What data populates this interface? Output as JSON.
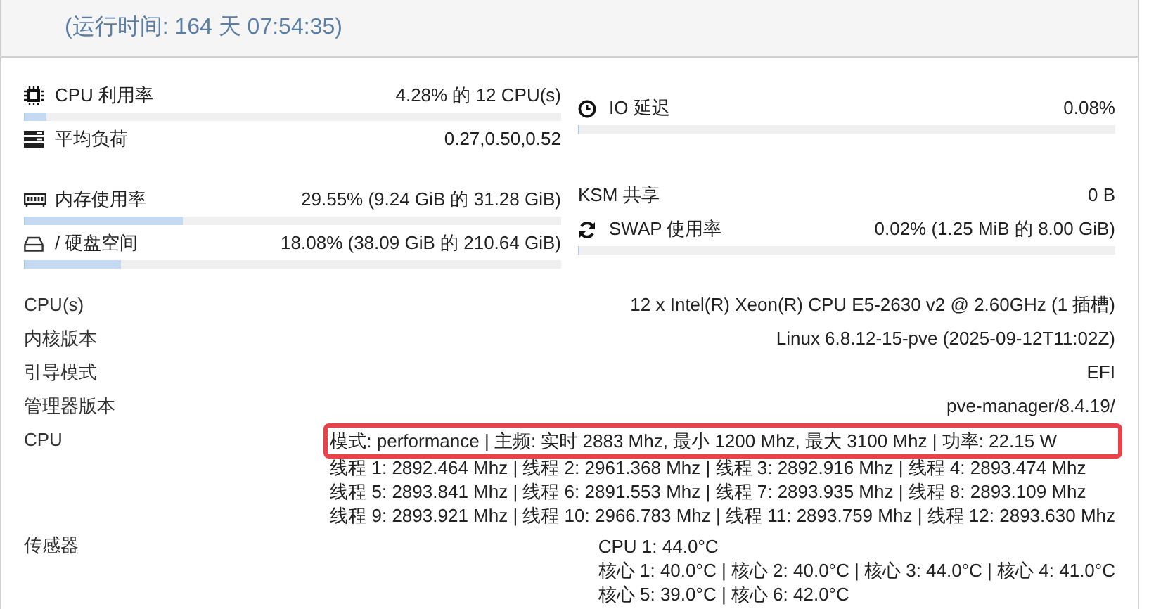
{
  "header": {
    "title": "(运行时间: 164 天 07:54:35)"
  },
  "summary_left": [
    {
      "label": "CPU 利用率",
      "value": "4.28% 的 12 CPU(s)",
      "level": 0.0428
    },
    {
      "label": "平均负荷",
      "value": "0.27,0.50,0.52"
    },
    {
      "label": "内存使用率",
      "value": "29.55% (9.24 GiB 的 31.28 GiB)",
      "level": 0.2955
    },
    {
      "label": "/ 硬盘空间",
      "value": "18.08% (38.09 GiB 的 210.64 GiB)",
      "level": 0.1808
    }
  ],
  "summary_right": [
    {
      "label": "IO 延迟",
      "value": "0.08%",
      "level": 0.0008
    },
    {
      "label": "KSM 共享",
      "value": "0 B"
    },
    {
      "label": "SWAP 使用率",
      "value": "0.02% (1.25 MiB 的 8.00 GiB)",
      "level": 0.0002
    }
  ],
  "details": [
    {
      "label": "CPU(s)",
      "lines": [
        {
          "text": "12 x Intel(R) Xeon(R) CPU E5-2630 v2 @ 2.60GHz (1 插槽)",
          "highlighted": false
        }
      ]
    },
    {
      "label": "内核版本",
      "lines": [
        {
          "text": "Linux 6.8.12-15-pve (2025-09-12T11:02Z)",
          "highlighted": false
        }
      ]
    },
    {
      "label": "引导模式",
      "lines": [
        {
          "text": "EFI",
          "highlighted": false
        }
      ]
    },
    {
      "label": "管理器版本",
      "lines": [
        {
          "text": "pve-manager/8.4.19/",
          "highlighted": false
        }
      ]
    },
    {
      "label": "CPU",
      "lines": [
        {
          "text": "模式: performance | 主频: 实时 2883 Mhz, 最小 1200 Mhz, 最大 3100 Mhz | 功率: 22.15 W",
          "highlighted": true
        },
        {
          "text": "线程 1: 2892.464 Mhz | 线程 2: 2961.368 Mhz | 线程 3: 2892.916 Mhz | 线程 4: 2893.474 Mhz",
          "highlighted": false
        },
        {
          "text": "线程 5: 2893.841 Mhz | 线程 6: 2891.553 Mhz | 线程 7: 2893.935 Mhz | 线程 8: 2893.109 Mhz",
          "highlighted": false
        },
        {
          "text": "线程 9: 2893.921 Mhz | 线程 10: 2966.783 Mhz | 线程 11: 2893.759 Mhz | 线程 12: 2893.630 Mhz",
          "highlighted": false
        }
      ]
    },
    {
      "label": "传感器",
      "lines": [
        {
          "text": "CPU 1: 44.0°C",
          "highlighted": false
        },
        {
          "text": "核心 1: 40.0°C | 核心 2: 40.0°C | 核心 3: 44.0°C | 核心 4: 41.0°C",
          "highlighted": false
        },
        {
          "text": "核心 5: 39.0°C | 核心 6: 42.0°C",
          "highlighted": false
        }
      ]
    }
  ]
}
